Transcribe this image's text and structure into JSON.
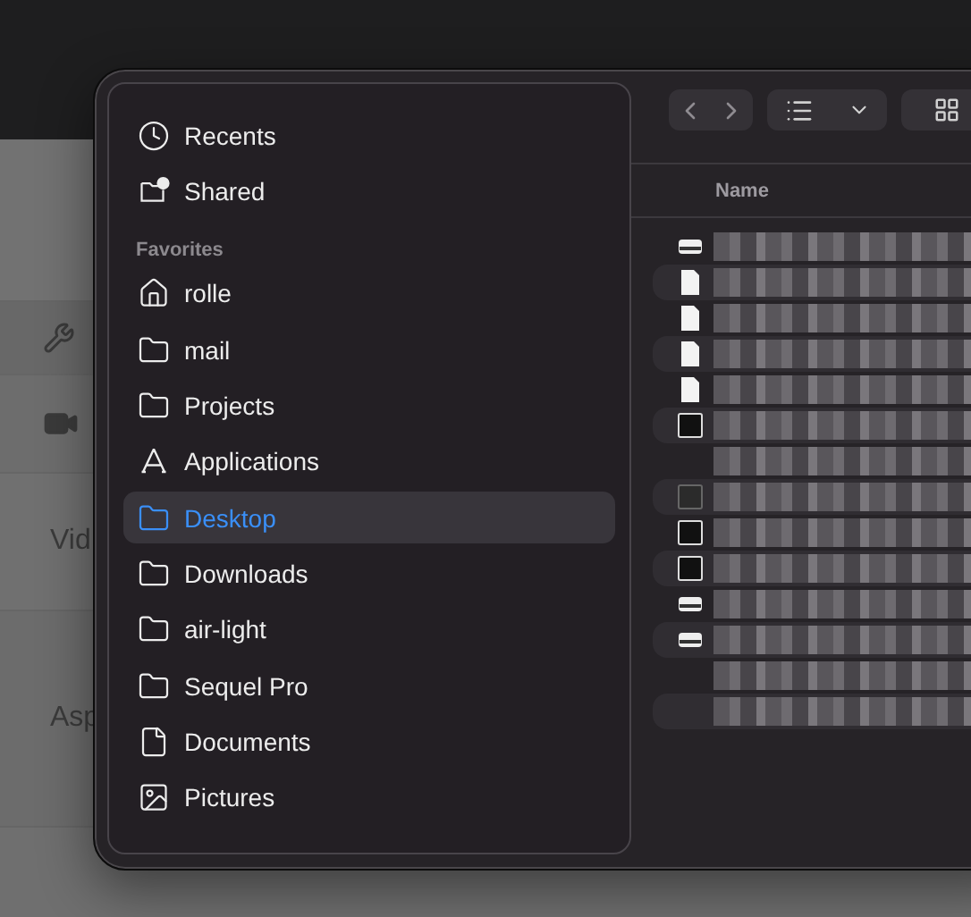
{
  "background": {
    "labels": [
      "Vid",
      "Asp"
    ]
  },
  "sidebar": {
    "items": [
      {
        "label": "Recents",
        "kind": "clock",
        "selected": false
      },
      {
        "label": "Shared",
        "kind": "shared",
        "selected": false
      }
    ],
    "section_title": "Favorites",
    "favorites": [
      {
        "label": "rolle",
        "kind": "home",
        "selected": false
      },
      {
        "label": "mail",
        "kind": "folder",
        "selected": false
      },
      {
        "label": "Projects",
        "kind": "folder",
        "selected": false
      },
      {
        "label": "Applications",
        "kind": "apps",
        "selected": false
      },
      {
        "label": "Desktop",
        "kind": "folder",
        "selected": true
      },
      {
        "label": "Downloads",
        "kind": "folder",
        "selected": false
      },
      {
        "label": "air-light",
        "kind": "folder",
        "selected": false
      },
      {
        "label": "Sequel Pro",
        "kind": "folder",
        "selected": false
      },
      {
        "label": "Documents",
        "kind": "document",
        "selected": false
      },
      {
        "label": "Pictures",
        "kind": "picture",
        "selected": false
      }
    ]
  },
  "file_list": {
    "columns": [
      "Name"
    ],
    "rows": [
      {
        "kind": "drive"
      },
      {
        "kind": "document"
      },
      {
        "kind": "document"
      },
      {
        "kind": "document"
      },
      {
        "kind": "document"
      },
      {
        "kind": "image"
      },
      {
        "kind": "none"
      },
      {
        "kind": "screen"
      },
      {
        "kind": "image"
      },
      {
        "kind": "image"
      },
      {
        "kind": "drive"
      },
      {
        "kind": "drive"
      },
      {
        "kind": "none"
      },
      {
        "kind": "none"
      }
    ]
  }
}
